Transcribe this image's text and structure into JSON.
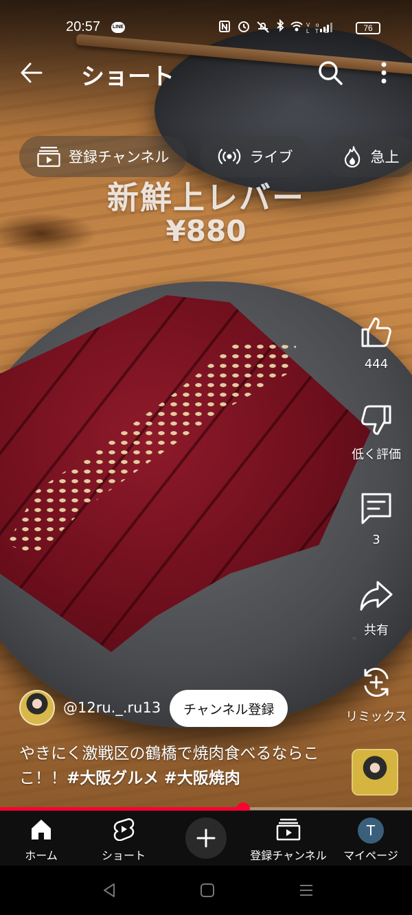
{
  "status_bar": {
    "time": "20:57",
    "line_badge": "LINE",
    "icons": [
      "nfc-icon",
      "alarm-icon",
      "mute-icon",
      "bluetooth-icon",
      "wifi-icon",
      "volte-icon",
      "signal-icon"
    ],
    "battery": "76"
  },
  "header": {
    "title": "ショート"
  },
  "chips": [
    {
      "label": "登録チャンネル",
      "icon": "subscriptions-icon"
    },
    {
      "label": "ライブ",
      "icon": "live-icon"
    },
    {
      "label": "急上",
      "icon": "trending-icon"
    }
  ],
  "video": {
    "overlay_title": "新鮮上レバー",
    "overlay_price": "¥880"
  },
  "actions": {
    "like": {
      "label": "444"
    },
    "dislike": {
      "label": "低く評価"
    },
    "comments": {
      "label": "3"
    },
    "share": {
      "label": "共有"
    },
    "remix": {
      "label": "リミックス"
    }
  },
  "channel": {
    "handle": "@12ru._.ru13",
    "subscribe_label": "チャンネル登録"
  },
  "caption": {
    "text": "やきにく激戦区の鶴橋で焼肉食べるならここ！！",
    "tags": [
      "#大阪グルメ",
      "#大阪焼肉"
    ]
  },
  "progress": {
    "fraction": 0.59
  },
  "bottom_nav": [
    {
      "label": "ホーム",
      "icon": "home-icon"
    },
    {
      "label": "ショート",
      "icon": "shorts-icon"
    },
    {
      "label": "",
      "icon": "plus-icon"
    },
    {
      "label": "登録チャンネル",
      "icon": "subscriptions-icon"
    },
    {
      "label": "マイページ",
      "icon": "profile-avatar",
      "avatar_letter": "T"
    }
  ],
  "colors": {
    "accent_red": "#ff0033",
    "nav_bg": "#0f0f0f"
  }
}
